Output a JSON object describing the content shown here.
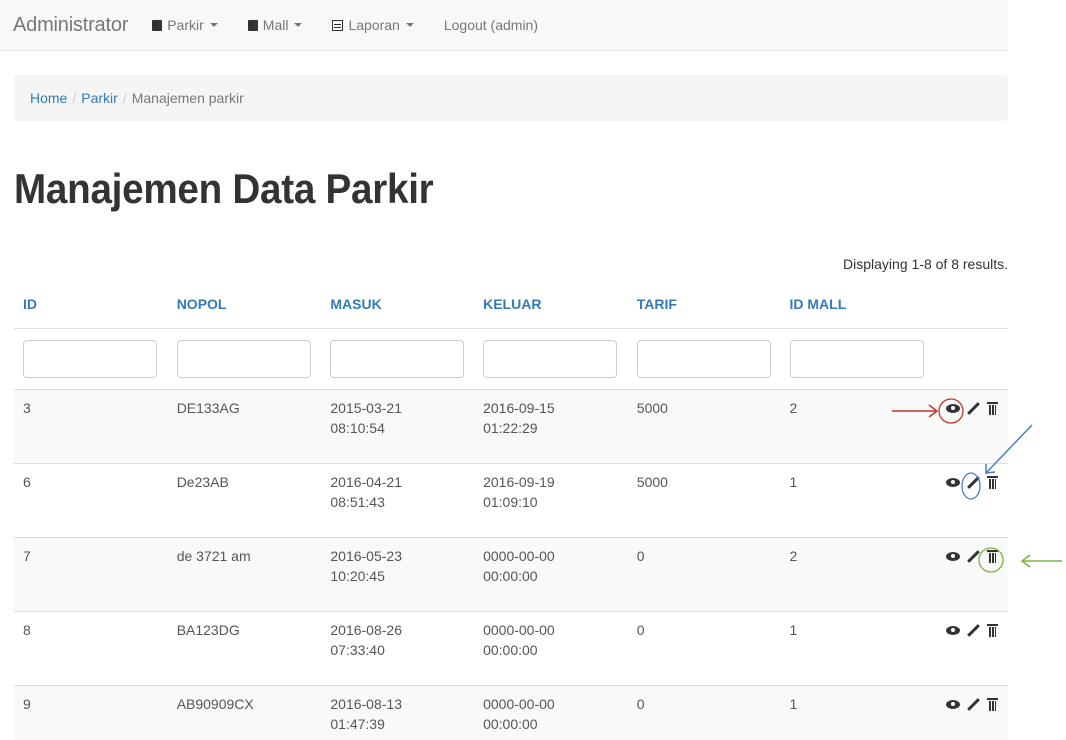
{
  "navbar": {
    "brand": "Administrator",
    "menu": [
      {
        "label": "Parkir",
        "icon": "book-icon"
      },
      {
        "label": "Mall",
        "icon": "book-icon"
      },
      {
        "label": "Laporan",
        "icon": "list-icon"
      }
    ],
    "logout": "Logout (admin)"
  },
  "breadcrumb": {
    "home": "Home",
    "parkir": "Parkir",
    "current": "Manajemen parkir"
  },
  "page": {
    "title": "Manajemen Data Parkir",
    "summary": "Displaying 1-8 of 8 results."
  },
  "table": {
    "headers": [
      "ID",
      "NOPOL",
      "MASUK",
      "KELUAR",
      "TARIF",
      "ID MALL"
    ],
    "rows": [
      {
        "id": "3",
        "nopol": "DE133AG",
        "masuk_date": "2015-03-21",
        "masuk_time": "08:10:54",
        "keluar_date": "2016-09-15",
        "keluar_time": "01:22:29",
        "tarif": "5000",
        "id_mall": "2"
      },
      {
        "id": "6",
        "nopol": "De23AB",
        "masuk_date": "2016-04-21",
        "masuk_time": "08:51:43",
        "keluar_date": "2016-09-19",
        "keluar_time": "01:09:10",
        "tarif": "5000",
        "id_mall": "1"
      },
      {
        "id": "7",
        "nopol": "de 3721 am",
        "masuk_date": "2016-05-23",
        "masuk_time": "10:20:45",
        "keluar_date": "0000-00-00",
        "keluar_time": "00:00:00",
        "tarif": "0",
        "id_mall": "2"
      },
      {
        "id": "8",
        "nopol": "BA123DG",
        "masuk_date": "2016-08-26",
        "masuk_time": "07:33:40",
        "keluar_date": "0000-00-00",
        "keluar_time": "00:00:00",
        "tarif": "0",
        "id_mall": "1"
      },
      {
        "id": "9",
        "nopol": "AB90909CX",
        "masuk_date": "2016-08-13",
        "masuk_time": "01:47:39",
        "keluar_date": "0000-00-00",
        "keluar_time": "00:00:00",
        "tarif": "0",
        "id_mall": "1"
      }
    ]
  },
  "annotations": {
    "view_color": "#c0392b",
    "update_color": "#4a7cc7",
    "delete_color": "#7cb342"
  }
}
